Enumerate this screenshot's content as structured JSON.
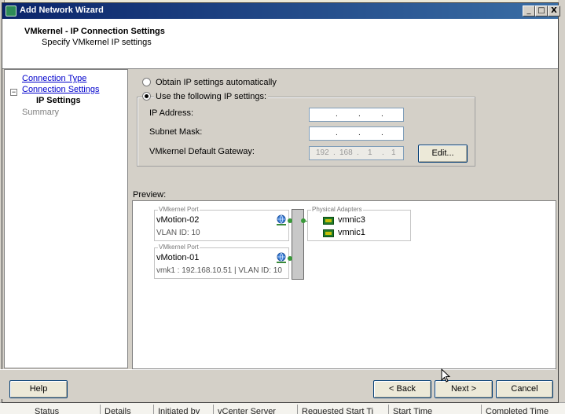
{
  "window": {
    "title": "Add Network Wizard",
    "controls": {
      "minimize": "_",
      "maximize": "□",
      "close": "X"
    }
  },
  "header": {
    "title": "VMkernel - IP Connection Settings",
    "subtitle": "Specify VMkernel IP settings"
  },
  "nav": {
    "connection_type": "Connection Type",
    "connection_settings": "Connection Settings",
    "ip_settings": "IP Settings",
    "summary": "Summary",
    "expander": "−"
  },
  "ip": {
    "auto_label": "Obtain IP settings automatically",
    "manual_label": "Use the following IP settings:",
    "selected": "manual",
    "ip_address_label": "IP Address:",
    "subnet_mask_label": "Subnet Mask:",
    "gateway_label": "VMkernel Default Gateway:",
    "dot": ".",
    "gateway_octets": [
      "192",
      "168",
      "1",
      "1"
    ],
    "edit_button": "Edit..."
  },
  "preview": {
    "label": "Preview:",
    "ports_caption": "VMkernel Port",
    "adapters_caption": "Physical Adapters",
    "port1_name": "vMotion-02",
    "port1_vlan": "VLAN ID: 10",
    "port2_name": "vMotion-01",
    "port2_detail": "vmk1 : 192.168.10.51 | VLAN ID: 10",
    "nic1": "vmnic3",
    "nic2": "vmnic1"
  },
  "buttons": {
    "help": "Help",
    "back": "< Back",
    "next": "Next >",
    "cancel": "Cancel"
  },
  "background_tasks": {
    "columns": [
      "Status",
      "Details",
      "Initiated by",
      "vCenter Server",
      "Requested Start Ti",
      "Start Time",
      "Completed Time"
    ]
  },
  "colors": {
    "titlebar": "#0a246a",
    "link": "#0000cc",
    "nic": "#1f7a2a",
    "connector": "#3a8a3a"
  }
}
